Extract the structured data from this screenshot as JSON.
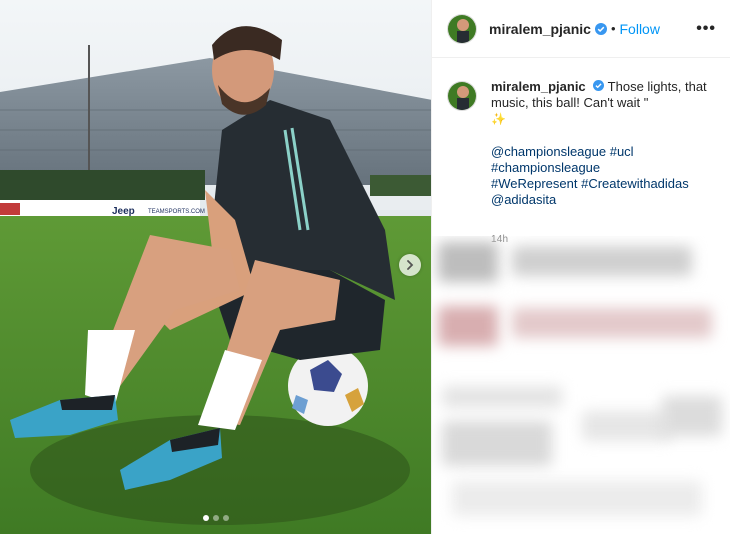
{
  "post": {
    "username": "miralem_pjanic",
    "follow_label": "Follow",
    "separator": "•",
    "more_label": "•••",
    "caption": {
      "text": "Those lights, that music, this ball! Can't wait \"",
      "emoji": "✨",
      "hashtags_line1": "@championsleague #ucl",
      "hashtags_line2": "#championsleague",
      "hashtags_line3": "#WeRepresent #Createwithadidas",
      "hashtags_line4": "@adidasita"
    },
    "timestamp": "14h",
    "carousel": {
      "count": 3,
      "active_index": 0
    }
  },
  "photo": {
    "board_text_1": "Jeep",
    "board_text_2": "TEAMSPORTS.COM"
  },
  "colors": {
    "link": "#00376b",
    "follow": "#0095f6",
    "verified": "#3897f0",
    "grass": "#4f8a2c",
    "sky": "#dfe7ec"
  }
}
